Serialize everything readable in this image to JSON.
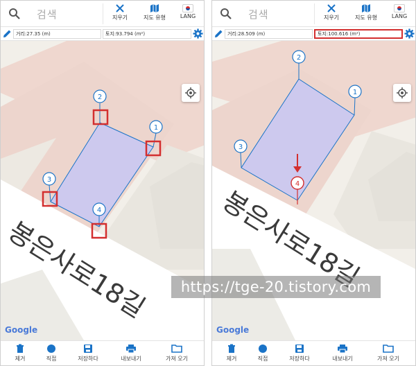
{
  "toolbar": {
    "search_placeholder": "검색",
    "clear_label": "지우기",
    "map_type_label": "지도 유형",
    "lang_label": "LANG"
  },
  "panels": {
    "left": {
      "distance": "거리:27.35 (m)",
      "area": "토지:93.794 (m²)",
      "point_labels": [
        "1",
        "2",
        "3",
        "4"
      ]
    },
    "right": {
      "distance": "거리:28.509 (m)",
      "area": "토지:100.616 (m²)",
      "point_labels": [
        "1",
        "2",
        "3",
        "4"
      ]
    }
  },
  "map": {
    "road_name": "봉은사로18길",
    "attribution": "Google"
  },
  "bottom_bar": {
    "delete_label": "제거",
    "direct_label": "직접",
    "save_label": "저장하다",
    "export_label": "내보내기",
    "import_label": "가져 오기"
  },
  "watermark": "https://tge-20.tistory.com",
  "colors": {
    "accent": "#1a73c7",
    "polygon_fill": "#c9c8f2",
    "highlight": "#d32f2f",
    "building": "#f0d9d3",
    "road": "#ffffff"
  },
  "icons": {
    "search": "search-icon",
    "clear": "close-icon",
    "map_type": "map-icon",
    "lang": "flag-icon",
    "edit": "pencil-icon",
    "settings": "gear-icon",
    "locate": "crosshair-icon",
    "delete": "trash-icon",
    "direct": "dot-icon",
    "save": "floppy-icon",
    "export": "printer-icon",
    "import": "folder-icon"
  }
}
